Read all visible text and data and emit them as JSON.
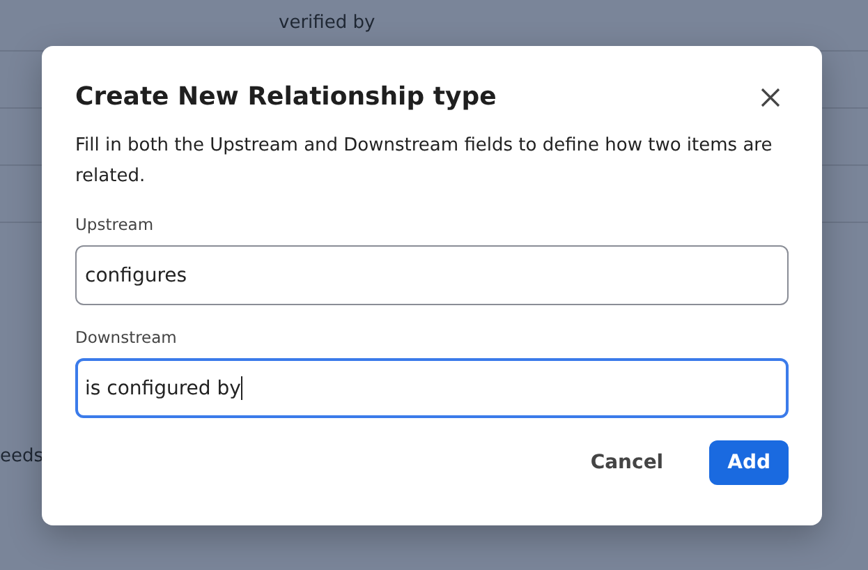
{
  "background": {
    "rows": [
      {
        "text": "verified by"
      },
      {
        "text": ""
      },
      {
        "text": ""
      },
      {
        "text": ""
      }
    ],
    "partial_text": "eeds"
  },
  "dialog": {
    "title": "Create New Relationship type",
    "description": "Fill in both the Upstream and Downstream fields to define how two items are related.",
    "fields": [
      {
        "label": "Upstream",
        "value": "configures",
        "focused": false
      },
      {
        "label": "Downstream",
        "value": "is configured by",
        "focused": true
      }
    ],
    "buttons": [
      {
        "label": "Cancel",
        "kind": "secondary"
      },
      {
        "label": "Add",
        "kind": "primary"
      }
    ]
  }
}
